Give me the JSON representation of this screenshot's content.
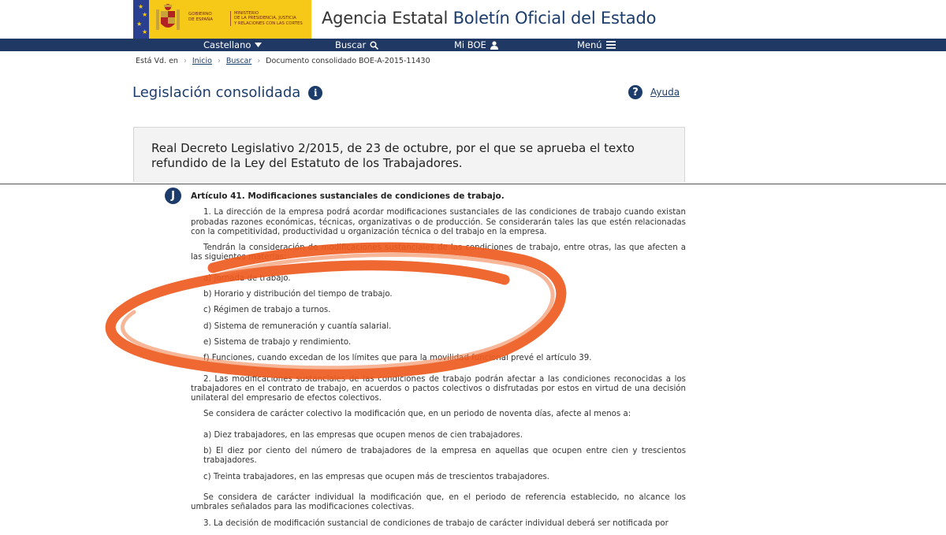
{
  "header": {
    "gov_label_line1": "GOBIERNO",
    "gov_label_line2": "DE ESPAÑA",
    "ministry_line1": "MINISTERIO",
    "ministry_line2": "DE LA PRESIDENCIA, JUSTICIA",
    "ministry_line3": "Y RELACIONES CON LAS CORTES",
    "agency_title_part1": "Agencia Estatal",
    "agency_title_part2": "Boletín Oficial del Estado"
  },
  "nav": {
    "language": "Castellano",
    "search": "Buscar",
    "myboe": "Mi BOE",
    "menu": "Menú"
  },
  "breadcrumb": {
    "prefix": "Está Vd. en",
    "home": "Inicio",
    "search": "Buscar",
    "current": "Documento consolidado BOE-A-2015-11430"
  },
  "section": {
    "title": "Legislación consolidada",
    "help": "Ayuda"
  },
  "law_title": "Real Decreto Legislativo 2/2015, de 23 de octubre, por el que se aprueba el texto refundido de la Ley del Estatuto de los Trabajadores.",
  "article": {
    "badge": "J",
    "title": "Artículo 41. Modificaciones sustanciales de condiciones de trabajo.",
    "p1": "1. La dirección de la empresa podrá acordar modificaciones sustanciales de las condiciones de trabajo cuando existan probadas razones económicas, técnicas, organizativas o de producción. Se considerarán tales las que estén relacionadas con la competitividad, productividad u organización técnica o del trabajo en la empresa.",
    "p2": "Tendrán la consideración de modificaciones sustanciales de las condiciones de trabajo, entre otras, las que afecten a las siguientes materias:",
    "list1": [
      "a) Jornada de trabajo.",
      "b) Horario y distribución del tiempo de trabajo.",
      "c) Régimen de trabajo a turnos.",
      "d) Sistema de remuneración y cuantía salarial.",
      "e) Sistema de trabajo y rendimiento.",
      "f) Funciones, cuando excedan de los límites que para la movilidad funcional prevé el artículo 39."
    ],
    "p3": "2. Las modificaciones sustanciales de las condiciones de trabajo podrán afectar a las condiciones reconocidas a los trabajadores en el contrato de trabajo, en acuerdos o pactos colectivos o disfrutadas por estos en virtud de una decisión unilateral del empresario de efectos colectivos.",
    "p4": "Se considera de carácter colectivo la modificación que, en un periodo de noventa días, afecte al menos a:",
    "list2": [
      "a) Diez trabajadores, en las empresas que ocupen menos de cien trabajadores.",
      "b) El diez por ciento del número de trabajadores de la empresa en aquellas que ocupen entre cien y trescientos trabajadores.",
      "c) Treinta trabajadores, en las empresas que ocupen más de trescientos trabajadores."
    ],
    "p5": "Se considera de carácter individual la modificación que, en el periodo de referencia establecido, no alcance los umbrales señalados para las modificaciones colectivas.",
    "p6": "3. La decisión de modificación sustancial de condiciones de trabajo de carácter individual deberá ser notificada por"
  },
  "colors": {
    "navy": "#203864",
    "flag_yellow": "#f6c918",
    "annotation": "#ee5a1f"
  }
}
